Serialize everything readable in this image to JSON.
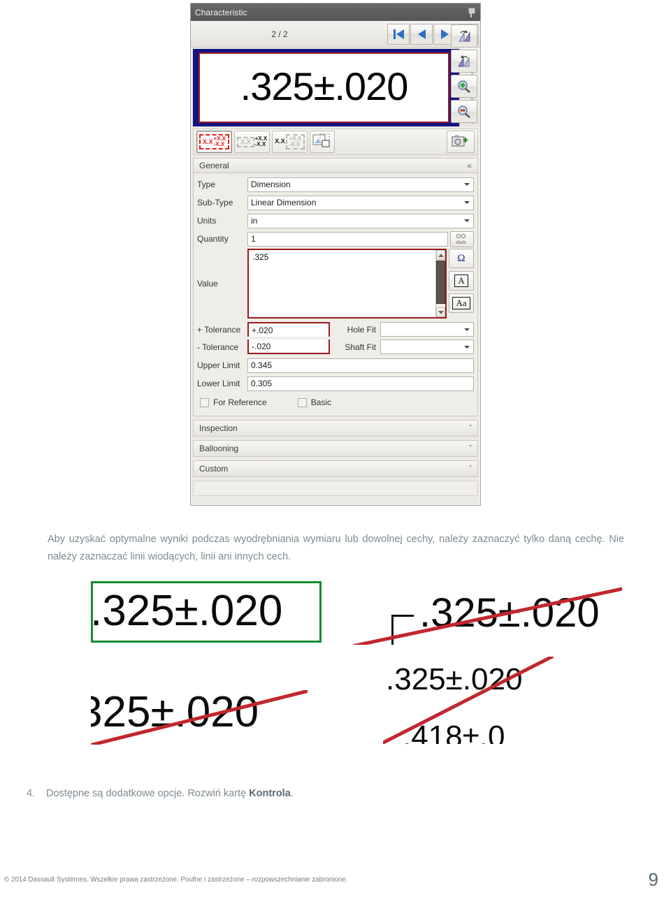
{
  "panel": {
    "title": "Characteristic",
    "pin_icon": "pin-icon",
    "counter": "2 / 2",
    "nav": {
      "first_label": "first-record",
      "prev_label": "previous-record",
      "next_label": "next-record",
      "last_label": "last-record"
    },
    "preview": {
      "dimension_text": ".325±.020"
    },
    "vtools": [
      {
        "name": "rotate-left-icon"
      },
      {
        "name": "rotate-right-icon"
      },
      {
        "name": "zoom-in-icon"
      },
      {
        "name": "zoom-out-icon"
      }
    ],
    "tolerance_modes": [
      {
        "name": "tolerance-mode-plus-minus",
        "top": "+X.X",
        "bottom": "-X.X",
        "base": "X.X",
        "selected": true
      },
      {
        "name": "tolerance-mode-limits",
        "top": "+X.X",
        "bottom": "-X.X",
        "base": "X.X",
        "selected": false
      },
      {
        "name": "tolerance-mode-bilateral",
        "top": "+X.X",
        "bottom": "-X.X",
        "base": "X.X",
        "selected": false
      },
      {
        "name": "tolerance-mode-image",
        "top": "",
        "bottom": "",
        "base": "",
        "selected": false
      }
    ],
    "capture_button": "capture-icon",
    "sections": {
      "general": {
        "title": "General",
        "chevron": "«",
        "fields": {
          "type_label": "Type",
          "type_value": "Dimension",
          "subtype_label": "Sub-Type",
          "subtype_value": "Linear Dimension",
          "units_label": "Units",
          "units_value": "in",
          "quantity_label": "Quantity",
          "quantity_value": "1",
          "quantity_button": "multi-instance-icon",
          "value_label": "Value",
          "value_text": ".325",
          "value_buttons": [
            {
              "name": "symbol-omega-button",
              "glyph": "Ω"
            },
            {
              "name": "font-uppercase-button",
              "glyph": "A"
            },
            {
              "name": "font-mixedcase-button",
              "glyph": "Aa"
            }
          ],
          "plus_tolerance_label": "+ Tolerance",
          "plus_tolerance_value": "+.020",
          "minus_tolerance_label": "- Tolerance",
          "minus_tolerance_value": "-.020",
          "hole_fit_label": "Hole Fit",
          "hole_fit_value": "",
          "shaft_fit_label": "Shaft Fit",
          "shaft_fit_value": "",
          "upper_limit_label": "Upper Limit",
          "upper_limit_value": "0.345",
          "lower_limit_label": "Lower Limit",
          "lower_limit_value": "0.305",
          "for_reference_label": "For Reference",
          "basic_label": "Basic"
        }
      },
      "inspection": {
        "title": "Inspection",
        "chevron": "ˇ"
      },
      "ballooning": {
        "title": "Ballooning",
        "chevron": "ˇ"
      },
      "custom": {
        "title": "Custom",
        "chevron": "ˇ"
      }
    }
  },
  "body": {
    "paragraph": "Aby uzyskać optymalne wyniki podczas wyodrębniania wymiaru lub dowolnej cechy, należy zaznaczyć tylko daną cechę. Nie należy zaznaczać linii wiodących, linii ani innych cech.",
    "step_number": "4.",
    "step_text_1": "Dostępne są dodatkowe opcje. Rozwiń kartę ",
    "step_text_bold": "Kontrola",
    "step_text_2": "."
  },
  "examples": {
    "good": {
      "name": "example-correct",
      "text": ".325±.020"
    },
    "bad_leader": {
      "name": "example-with-leader-line",
      "text": ".325±.020"
    },
    "bad_partial": {
      "name": "example-partial-crop",
      "text": "325±.020"
    },
    "bad_extra": {
      "name": "example-extra-dimension",
      "text": ".325±.020",
      "text2": ".418±.0"
    }
  },
  "footer": {
    "copyright": "© 2014 Dassault Systèmes. Wszelkie prawa zastrzeżone. Poufne i zastrzeżone – rozpowszechnianie zabronione.",
    "page_number": "9"
  },
  "colors": {
    "accent_blue": "#131384",
    "highlight_red": "#9b1b20",
    "correct_green": "#1a8a2e",
    "strike_red": "#c1272d",
    "text_grey": "#7e8a90"
  }
}
